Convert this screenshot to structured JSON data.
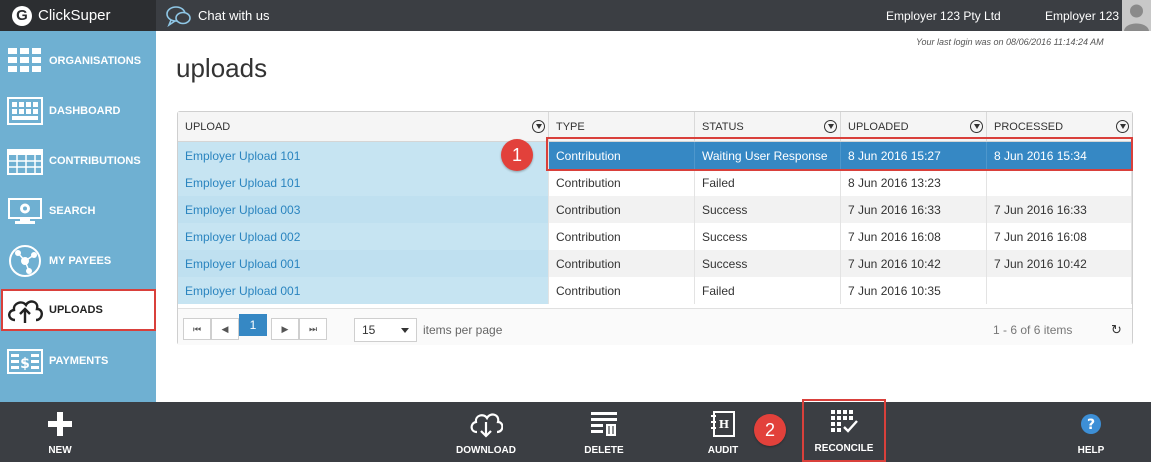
{
  "brand": {
    "name": "ClickSuper",
    "logo_letter": "G"
  },
  "topbar": {
    "chat_label": "Chat with us",
    "company": "Employer 123 Pty Ltd",
    "user": "Employer 123"
  },
  "last_login": "Your last login was on 08/06/2016 11:14:24 AM",
  "page_title": "uploads",
  "sidebar": {
    "items": [
      {
        "label": "ORGANISATIONS",
        "icon": "organisations-icon"
      },
      {
        "label": "DASHBOARD",
        "icon": "dashboard-icon"
      },
      {
        "label": "CONTRIBUTIONS",
        "icon": "contributions-icon"
      },
      {
        "label": "SEARCH",
        "icon": "search-icon"
      },
      {
        "label": "MY PAYEES",
        "icon": "payees-icon"
      },
      {
        "label": "UPLOADS",
        "icon": "upload-cloud-icon",
        "active": true
      },
      {
        "label": "PAYMENTS",
        "icon": "payments-icon"
      }
    ]
  },
  "table": {
    "columns": [
      "UPLOAD",
      "TYPE",
      "STATUS",
      "UPLOADED",
      "PROCESSED"
    ],
    "rows": [
      {
        "upload": "Employer Upload 101",
        "type": "Contribution",
        "status": "Waiting User Response",
        "uploaded": "8 Jun 2016 15:27",
        "processed": "8 Jun 2016 15:34",
        "selected": true
      },
      {
        "upload": "Employer Upload 101",
        "type": "Contribution",
        "status": "Failed",
        "uploaded": "8 Jun 2016 13:23",
        "processed": ""
      },
      {
        "upload": "Employer Upload 003",
        "type": "Contribution",
        "status": "Success",
        "uploaded": "7 Jun 2016 16:33",
        "processed": "7 Jun 2016 16:33"
      },
      {
        "upload": "Employer Upload 002",
        "type": "Contribution",
        "status": "Success",
        "uploaded": "7 Jun 2016 16:08",
        "processed": "7 Jun 2016 16:08"
      },
      {
        "upload": "Employer Upload 001",
        "type": "Contribution",
        "status": "Success",
        "uploaded": "7 Jun 2016 10:42",
        "processed": "7 Jun 2016 10:42"
      },
      {
        "upload": "Employer Upload 001",
        "type": "Contribution",
        "status": "Failed",
        "uploaded": "7 Jun 2016 10:35",
        "processed": ""
      }
    ]
  },
  "pager": {
    "first": "⏮",
    "prev": "◀",
    "current_page": "1",
    "next": "▶",
    "last": "⏭",
    "page_size": "15",
    "items_per_page_label": "items per page",
    "count_label": "1 - 6 of 6 items"
  },
  "annotations": {
    "step1": "1",
    "step2": "2"
  },
  "actions": {
    "new": "NEW",
    "download": "DOWNLOAD",
    "delete": "DELETE",
    "audit": "AUDIT",
    "reconcile": "RECONCILE",
    "help": "HELP"
  },
  "colors": {
    "sidebar": "#6fb0d2",
    "bar": "#3b3e43",
    "selected_row": "#3688c4",
    "highlight": "#d9403b",
    "upload_column": "#c6e4f2"
  }
}
